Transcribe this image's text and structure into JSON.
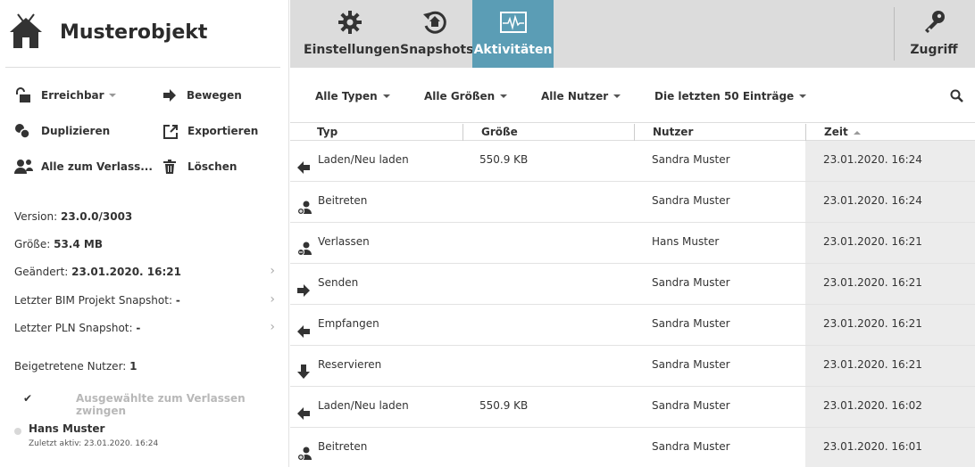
{
  "object": {
    "title": "Musterobjekt"
  },
  "actions": [
    {
      "label": "Erreichbar",
      "icon": "unlock-icon",
      "dropdown": true
    },
    {
      "label": "Bewegen",
      "icon": "arrow-right-icon"
    },
    {
      "label": "Duplizieren",
      "icon": "duplicate-icon"
    },
    {
      "label": "Exportieren",
      "icon": "export-icon"
    },
    {
      "label": "Alle zum Verlass...",
      "icon": "users-leave-icon"
    },
    {
      "label": "Löschen",
      "icon": "trash-icon"
    }
  ],
  "info": {
    "version_label": "Version: ",
    "version_value": "23.0.0/3003",
    "size_label": "Größe: ",
    "size_value": "53.4 MB",
    "changed_label": "Geändert: ",
    "changed_value": "23.01.2020. 16:21",
    "bim_label": "Letzter BIM Projekt Snapshot: ",
    "bim_value": "-",
    "pln_label": "Letzter PLN Snapshot: ",
    "pln_value": "-",
    "joined_label": "Beigetretene Nutzer: ",
    "joined_value": "1"
  },
  "force_leave_label": "Ausgewählte zum Verlassen zwingen",
  "user": {
    "name": "Hans Muster",
    "last_active": "Zuletzt aktiv: 23.01.2020. 16:24"
  },
  "tabs": [
    {
      "label": "Einstellungen",
      "icon": "gear-icon",
      "active": false
    },
    {
      "label": "Snapshots",
      "icon": "snapshot-icon",
      "active": false
    },
    {
      "label": "Aktivitäten",
      "icon": "activity-icon",
      "active": true
    }
  ],
  "access": {
    "label": "Zugriff",
    "icon": "key-icon"
  },
  "filters": {
    "types": "Alle Typen",
    "sizes": "Alle Größen",
    "users": "Alle Nutzer",
    "entries": "Die letzten 50 Einträge"
  },
  "table": {
    "columns": {
      "typ": "Typ",
      "size": "Größe",
      "user": "Nutzer",
      "zeit": "Zeit"
    },
    "rows": [
      {
        "icon": "arrow-left-icon",
        "typ": "Laden/Neu laden",
        "size": "550.9 KB",
        "user": "Sandra Muster",
        "zeit": "23.01.2020. 16:24"
      },
      {
        "icon": "user-join-icon",
        "typ": "Beitreten",
        "size": "",
        "user": "Sandra Muster",
        "zeit": "23.01.2020. 16:24"
      },
      {
        "icon": "user-leave-icon",
        "typ": "Verlassen",
        "size": "",
        "user": "Hans Muster",
        "zeit": "23.01.2020. 16:21"
      },
      {
        "icon": "arrow-right-icon",
        "typ": "Senden",
        "size": "",
        "user": "Sandra Muster",
        "zeit": "23.01.2020. 16:21"
      },
      {
        "icon": "arrow-left-icon",
        "typ": "Empfangen",
        "size": "",
        "user": "Sandra Muster",
        "zeit": "23.01.2020. 16:21"
      },
      {
        "icon": "arrow-down-icon",
        "typ": "Reservieren",
        "size": "",
        "user": "Sandra Muster",
        "zeit": "23.01.2020. 16:21"
      },
      {
        "icon": "arrow-left-icon",
        "typ": "Laden/Neu laden",
        "size": "550.9 KB",
        "user": "Sandra Muster",
        "zeit": "23.01.2020. 16:02"
      },
      {
        "icon": "user-join-icon",
        "typ": "Beitreten",
        "size": "",
        "user": "Sandra Muster",
        "zeit": "23.01.2020. 16:01"
      }
    ]
  },
  "colors": {
    "accent": "#5b9db5",
    "topbar": "#dcdcdc",
    "zeit_bg": "#ececec"
  }
}
